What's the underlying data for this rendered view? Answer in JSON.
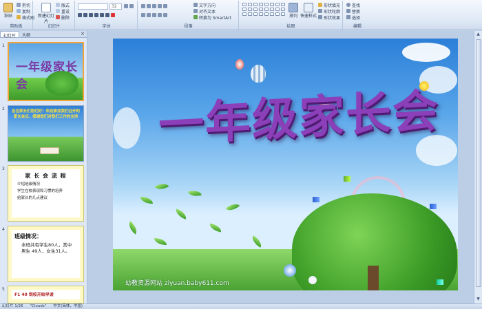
{
  "ribbon": {
    "clipboard": {
      "label": "剪贴板",
      "paste": "粘贴",
      "cut": "剪切",
      "copy": "复制",
      "format_painter": "格式刷"
    },
    "slides": {
      "label": "幻灯片",
      "new_slide": "新建幻灯片",
      "layout": "版式",
      "reset": "重设",
      "delete": "删除"
    },
    "font": {
      "label": "字体",
      "font_name": "",
      "font_size": "32"
    },
    "paragraph": {
      "label": "段落",
      "text_direction": "文字方向",
      "align_text": "对齐文本",
      "convert_smartart": "转换为 SmartArt"
    },
    "drawing": {
      "label": "绘图",
      "arrange": "排列",
      "quick_styles": "快速样式",
      "shape_fill": "形状填充",
      "shape_outline": "形状轮廓",
      "shape_effects": "形状效果"
    },
    "editing": {
      "label": "编辑",
      "find": "查找",
      "replace": "替换",
      "select": "选择"
    }
  },
  "panel": {
    "tab_slides": "幻灯片",
    "tab_outline": "大纲",
    "close": "×",
    "thumbnails": [
      {
        "number": "1",
        "title": "一年级家长会"
      },
      {
        "number": "2",
        "text": "各位家长们您们好！欢迎参加我们召开的家长会议，感谢您们对我们工作的支持"
      },
      {
        "number": "3",
        "heading": "家 长 会 流 程",
        "items": [
          "介绍班级情况",
          "学生在校表现和习惯的培养",
          "给家长的几点建议"
        ]
      },
      {
        "number": "4",
        "heading": "班级情况：",
        "body": "本班共有学生80人，其中男生 49人，女生31人。"
      },
      {
        "number": "5",
        "heading": "F1 40 到校开始早读"
      }
    ]
  },
  "slide": {
    "title": "一年级家长会",
    "watermark": "幼教资源网站  ziyuan.baby611.com"
  },
  "status": {
    "slide_info": "幻灯片 1/26",
    "theme": "\"Clouds\"",
    "language": "中文(简体，中国)"
  },
  "colors": {
    "title": "#8b3fb8",
    "ribbon_bg": "#dfe9f6",
    "selection": "#f2a33a"
  }
}
